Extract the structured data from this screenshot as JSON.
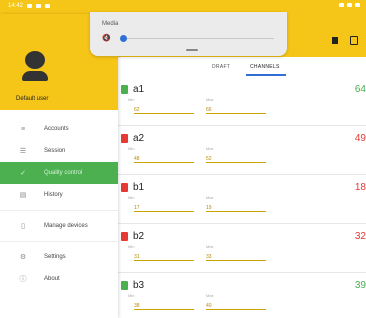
{
  "status_bar": {
    "time": "14:42"
  },
  "media": {
    "title": "Media",
    "speaker_icon": "volume-muted-icon"
  },
  "drawer": {
    "user_name": "Default user",
    "items": [
      {
        "label": "Accounts",
        "icon": "accounts-icon"
      },
      {
        "label": "Session",
        "icon": "session-icon"
      },
      {
        "label": "Quality control",
        "icon": "quality-icon",
        "active": true
      },
      {
        "label": "History",
        "icon": "history-icon"
      },
      {
        "label": "Manage devices",
        "icon": "device-icon"
      },
      {
        "label": "Settings",
        "icon": "gear-icon"
      },
      {
        "label": "About",
        "icon": "info-icon"
      }
    ]
  },
  "tabs": {
    "draft": "DRAFT",
    "channels": "CHANNELS"
  },
  "channels": [
    {
      "name": "a1",
      "value": "64",
      "status": "green",
      "f1": "62",
      "f2": "66",
      "l1": "Min",
      "l2": "Max"
    },
    {
      "name": "a2",
      "value": "49",
      "status": "red",
      "f1": "48",
      "f2": "52",
      "l1": "Min",
      "l2": "Max"
    },
    {
      "name": "b1",
      "value": "18",
      "status": "red",
      "f1": "17",
      "f2": "19",
      "l1": "Min",
      "l2": "Max"
    },
    {
      "name": "b2",
      "value": "32",
      "status": "red",
      "f1": "31",
      "f2": "33",
      "l1": "Min",
      "l2": "Max"
    },
    {
      "name": "b3",
      "value": "39",
      "status": "green",
      "f1": "38",
      "f2": "40",
      "l1": "Min",
      "l2": "Max"
    }
  ],
  "colors": {
    "accent": "#f5c518",
    "active": "#4caf50",
    "ok": "#4caf50",
    "alert": "#e53935"
  }
}
